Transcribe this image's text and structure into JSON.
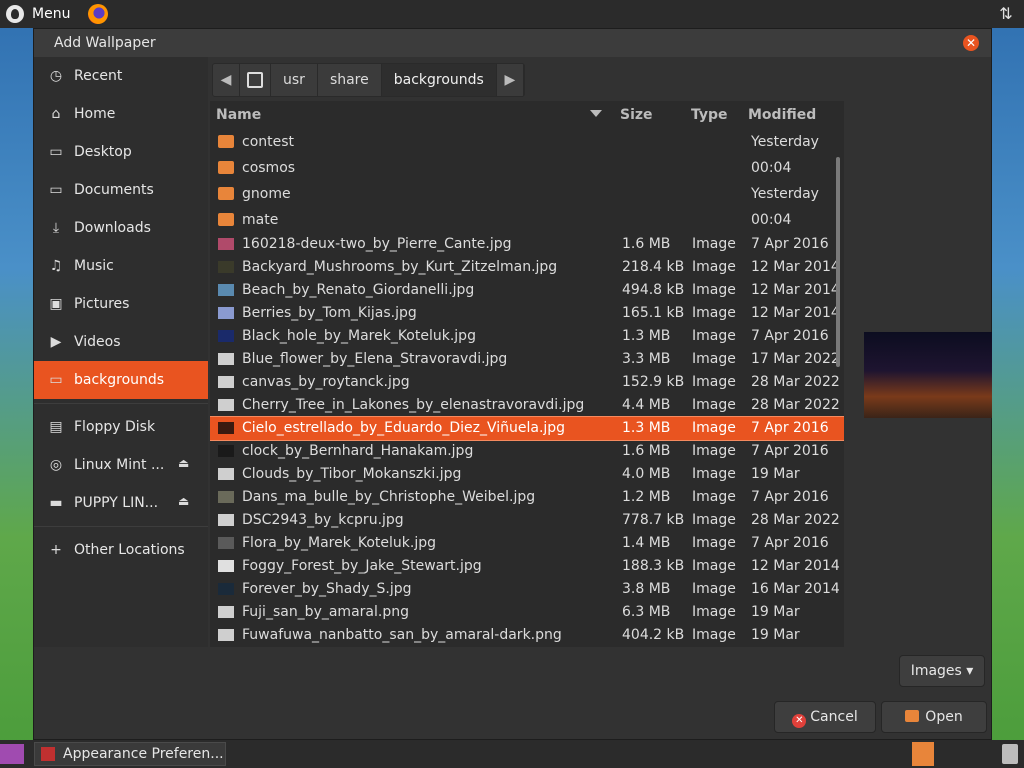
{
  "top_panel": {
    "menu_label": "Menu"
  },
  "dialog": {
    "title": "Add Wallpaper"
  },
  "sidebar": {
    "items": [
      {
        "label": "Recent",
        "icon": "clock-icon"
      },
      {
        "label": "Home",
        "icon": "home-icon"
      },
      {
        "label": "Desktop",
        "icon": "folder-icon"
      },
      {
        "label": "Documents",
        "icon": "folder-icon"
      },
      {
        "label": "Downloads",
        "icon": "download-icon"
      },
      {
        "label": "Music",
        "icon": "music-icon"
      },
      {
        "label": "Pictures",
        "icon": "picture-icon"
      },
      {
        "label": "Videos",
        "icon": "video-icon"
      },
      {
        "label": "backgrounds",
        "icon": "folder-icon"
      },
      {
        "label": "Floppy Disk",
        "icon": "floppy-icon"
      },
      {
        "label": "Linux Mint ...",
        "icon": "disc-icon"
      },
      {
        "label": "PUPPY LIN...",
        "icon": "drive-icon"
      },
      {
        "label": "Other Locations",
        "icon": "plus-icon"
      }
    ]
  },
  "pathbar": {
    "segments": [
      "usr",
      "share",
      "backgrounds"
    ]
  },
  "columns": {
    "name": "Name",
    "size": "Size",
    "type": "Type",
    "modified": "Modified"
  },
  "folders": [
    {
      "name": "contest",
      "modified": "Yesterday"
    },
    {
      "name": "cosmos",
      "modified": "00:04"
    },
    {
      "name": "gnome",
      "modified": "Yesterday"
    },
    {
      "name": "mate",
      "modified": "00:04"
    }
  ],
  "files": [
    {
      "name": "160218-deux-two_by_Pierre_Cante.jpg",
      "size": "1.6 MB",
      "type": "Image",
      "modified": "7 Apr 2016",
      "thumb": "#b04a6a"
    },
    {
      "name": "Backyard_Mushrooms_by_Kurt_Zitzelman.jpg",
      "size": "218.4 kB",
      "type": "Image",
      "modified": "12 Mar 2014",
      "thumb": "#3a3a2a"
    },
    {
      "name": "Beach_by_Renato_Giordanelli.jpg",
      "size": "494.8 kB",
      "type": "Image",
      "modified": "12 Mar 2014",
      "thumb": "#5a8ab0"
    },
    {
      "name": "Berries_by_Tom_Kijas.jpg",
      "size": "165.1 kB",
      "type": "Image",
      "modified": "12 Mar 2014",
      "thumb": "#8a9ad0"
    },
    {
      "name": "Black_hole_by_Marek_Koteluk.jpg",
      "size": "1.3 MB",
      "type": "Image",
      "modified": "7 Apr 2016",
      "thumb": "#1a2a6a"
    },
    {
      "name": "Blue_flower_by_Elena_Stravoravdi.jpg",
      "size": "3.3 MB",
      "type": "Image",
      "modified": "17 Mar 2022",
      "thumb": "#cfcfcf"
    },
    {
      "name": "canvas_by_roytanck.jpg",
      "size": "152.9 kB",
      "type": "Image",
      "modified": "28 Mar 2022",
      "thumb": "#cfcfcf"
    },
    {
      "name": "Cherry_Tree_in_Lakones_by_elenastravoravdi.jpg",
      "size": "4.4 MB",
      "type": "Image",
      "modified": "28 Mar 2022",
      "thumb": "#cfcfcf"
    },
    {
      "name": "Cielo_estrellado_by_Eduardo_Diez_Viñuela.jpg",
      "size": "1.3 MB",
      "type": "Image",
      "modified": "7 Apr 2016",
      "thumb": "#3a1a10"
    },
    {
      "name": "clock_by_Bernhard_Hanakam.jpg",
      "size": "1.6 MB",
      "type": "Image",
      "modified": "7 Apr 2016",
      "thumb": "#1a1a1a"
    },
    {
      "name": "Clouds_by_Tibor_Mokanszki.jpg",
      "size": "4.0 MB",
      "type": "Image",
      "modified": "19 Mar",
      "thumb": "#cfcfcf"
    },
    {
      "name": "Dans_ma_bulle_by_Christophe_Weibel.jpg",
      "size": "1.2 MB",
      "type": "Image",
      "modified": "7 Apr 2016",
      "thumb": "#6a6a5a"
    },
    {
      "name": "DSC2943_by_kcpru.jpg",
      "size": "778.7 kB",
      "type": "Image",
      "modified": "28 Mar 2022",
      "thumb": "#cfcfcf"
    },
    {
      "name": "Flora_by_Marek_Koteluk.jpg",
      "size": "1.4 MB",
      "type": "Image",
      "modified": "7 Apr 2016",
      "thumb": "#5a5a5a"
    },
    {
      "name": "Foggy_Forest_by_Jake_Stewart.jpg",
      "size": "188.3 kB",
      "type": "Image",
      "modified": "12 Mar 2014",
      "thumb": "#e0e0e0"
    },
    {
      "name": "Forever_by_Shady_S.jpg",
      "size": "3.8 MB",
      "type": "Image",
      "modified": "16 Mar 2014",
      "thumb": "#1a2a3a"
    },
    {
      "name": "Fuji_san_by_amaral.png",
      "size": "6.3 MB",
      "type": "Image",
      "modified": "19 Mar",
      "thumb": "#cfcfcf"
    },
    {
      "name": "Fuwafuwa_nanbatto_san_by_amaral-dark.png",
      "size": "404.2 kB",
      "type": "Image",
      "modified": "19 Mar",
      "thumb": "#cfcfcf"
    }
  ],
  "selected_file_index": 8,
  "filter": {
    "label": "Images"
  },
  "buttons": {
    "cancel": "Cancel",
    "open": "Open"
  },
  "taskbar": {
    "app_label": "Appearance Preferen..."
  },
  "colors": {
    "accent": "#e95420",
    "dialog_bg": "#323232",
    "sidebar_bg": "#2e2e2e",
    "list_bg": "#2b2b2b"
  }
}
